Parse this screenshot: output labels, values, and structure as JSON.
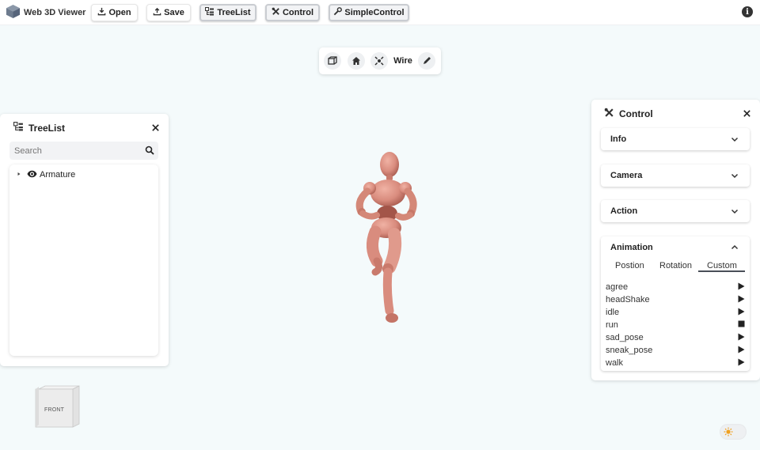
{
  "app": {
    "title": "Web 3D Viewer"
  },
  "toolbar": {
    "open_label": "Open",
    "save_label": "Save",
    "treelist_label": "TreeList",
    "control_label": "Control",
    "simplecontrol_label": "SimpleControl",
    "info_icon": "i"
  },
  "viewport_toolbar": {
    "items": [
      "cube-icon",
      "home-icon",
      "fit-view-icon",
      "Wire",
      "measure-icon"
    ],
    "wire_label": "Wire"
  },
  "treelist": {
    "title": "TreeList",
    "search": {
      "placeholder": "Search",
      "value": "Search"
    },
    "nodes": [
      {
        "label": "Armature",
        "visible": true,
        "expanded": false
      }
    ]
  },
  "control": {
    "title": "Control",
    "sections": [
      {
        "label": "Info",
        "expanded": false
      },
      {
        "label": "Camera",
        "expanded": false
      },
      {
        "label": "Action",
        "expanded": false
      },
      {
        "label": "Animation",
        "expanded": true
      }
    ],
    "animation": {
      "tabs": [
        "Postion",
        "Rotation",
        "Custom"
      ],
      "active_tab": "Custom",
      "items": [
        {
          "name": "agree",
          "state": "play"
        },
        {
          "name": "headShake",
          "state": "play"
        },
        {
          "name": "idle",
          "state": "play"
        },
        {
          "name": "run",
          "state": "stop"
        },
        {
          "name": "sad_pose",
          "state": "play"
        },
        {
          "name": "sneak_pose",
          "state": "play"
        },
        {
          "name": "walk",
          "state": "play"
        }
      ]
    }
  },
  "view_cube": {
    "face_label": "FRONT"
  },
  "colors": {
    "background": "#f4fafb",
    "mannequin": "#d98c7e",
    "dark_text": "#222222"
  }
}
